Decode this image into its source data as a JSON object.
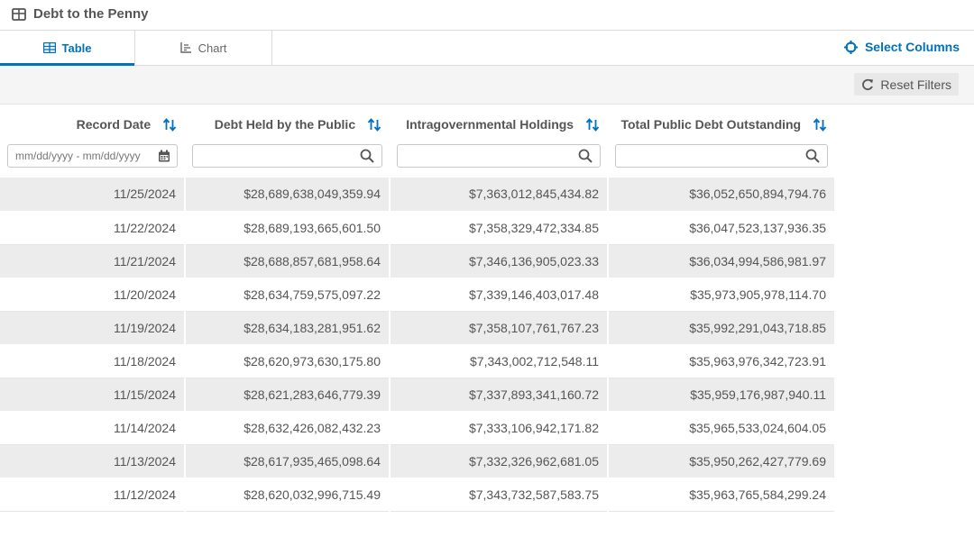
{
  "header": {
    "title": "Debt to the Penny",
    "icon": "table-icon"
  },
  "tabs": [
    {
      "label": "Table",
      "icon": "table-icon",
      "active": true
    },
    {
      "label": "Chart",
      "icon": "chart-icon",
      "active": false
    }
  ],
  "toolbar": {
    "select_columns_label": "Select Columns",
    "reset_filters_label": "Reset Filters"
  },
  "accent_color": "#0071bc",
  "columns": [
    {
      "label": "Record Date"
    },
    {
      "label": "Debt Held by the Public"
    },
    {
      "label": "Intragovernmental Holdings"
    },
    {
      "label": "Total Public Debt Outstanding"
    }
  ],
  "filters": {
    "date_placeholder": "mm/dd/yyyy - mm/dd/yyyy"
  },
  "rows": [
    [
      "11/25/2024",
      "$28,689,638,049,359.94",
      "$7,363,012,845,434.82",
      "$36,052,650,894,794.76"
    ],
    [
      "11/22/2024",
      "$28,689,193,665,601.50",
      "$7,358,329,472,334.85",
      "$36,047,523,137,936.35"
    ],
    [
      "11/21/2024",
      "$28,688,857,681,958.64",
      "$7,346,136,905,023.33",
      "$36,034,994,586,981.97"
    ],
    [
      "11/20/2024",
      "$28,634,759,575,097.22",
      "$7,339,146,403,017.48",
      "$35,973,905,978,114.70"
    ],
    [
      "11/19/2024",
      "$28,634,183,281,951.62",
      "$7,358,107,761,767.23",
      "$35,992,291,043,718.85"
    ],
    [
      "11/18/2024",
      "$28,620,973,630,175.80",
      "$7,343,002,712,548.11",
      "$35,963,976,342,723.91"
    ],
    [
      "11/15/2024",
      "$28,621,283,646,779.39",
      "$7,337,893,341,160.72",
      "$35,959,176,987,940.11"
    ],
    [
      "11/14/2024",
      "$28,632,426,082,432.23",
      "$7,333,106,942,171.82",
      "$35,965,533,024,604.05"
    ],
    [
      "11/13/2024",
      "$28,617,935,465,098.64",
      "$7,332,326,962,681.05",
      "$35,950,262,427,779.69"
    ],
    [
      "11/12/2024",
      "$28,620,032,996,715.49",
      "$7,343,732,587,583.75",
      "$35,963,765,584,299.24"
    ]
  ]
}
